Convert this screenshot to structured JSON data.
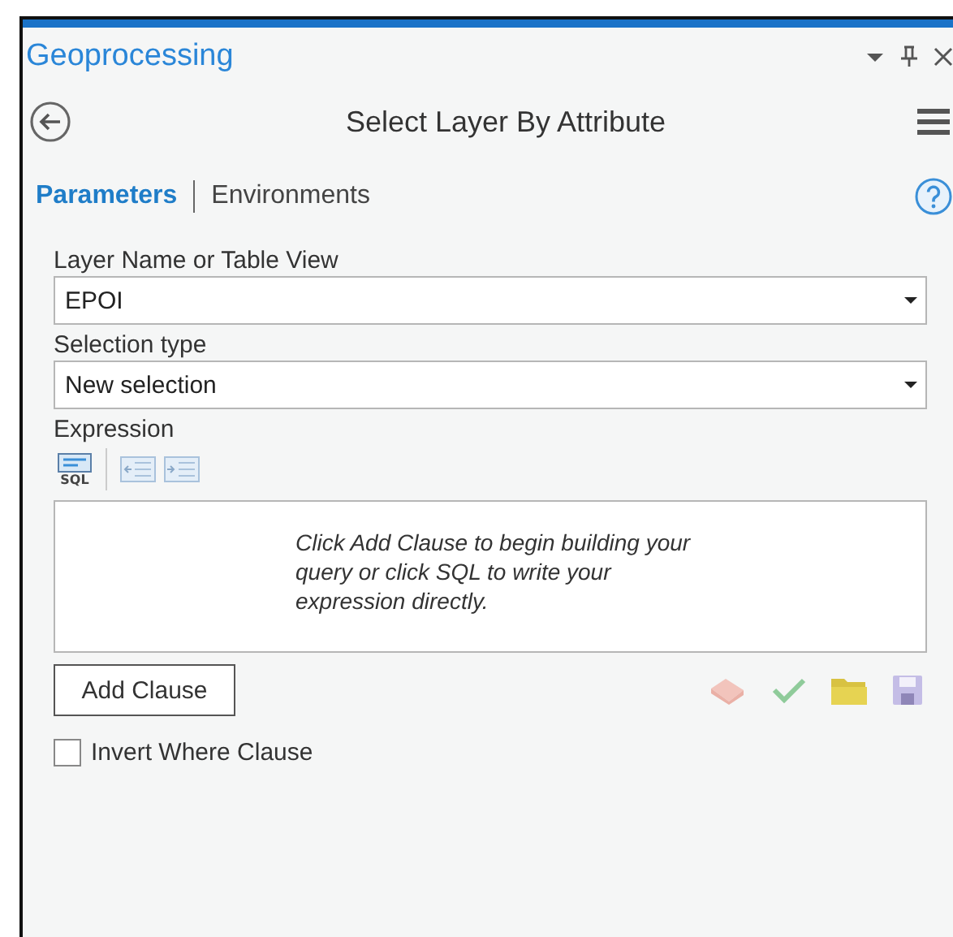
{
  "pane": {
    "title": "Geoprocessing"
  },
  "tool": {
    "title": "Select Layer By Attribute"
  },
  "tabs": [
    {
      "label": "Parameters",
      "selected": true
    },
    {
      "label": "Environments",
      "selected": false
    }
  ],
  "parameters": [
    {
      "label": "Layer Name or Table View",
      "value": "EPOI"
    },
    {
      "label": "Selection type",
      "value": "New selection"
    }
  ],
  "expression": {
    "label": "Expression",
    "sql_button": "SQL",
    "hint": "Click Add Clause to begin building your query or click SQL to write your expression directly.",
    "add_button": "Add Clause"
  },
  "invert": {
    "label": "Invert Where Clause",
    "checked": false
  }
}
